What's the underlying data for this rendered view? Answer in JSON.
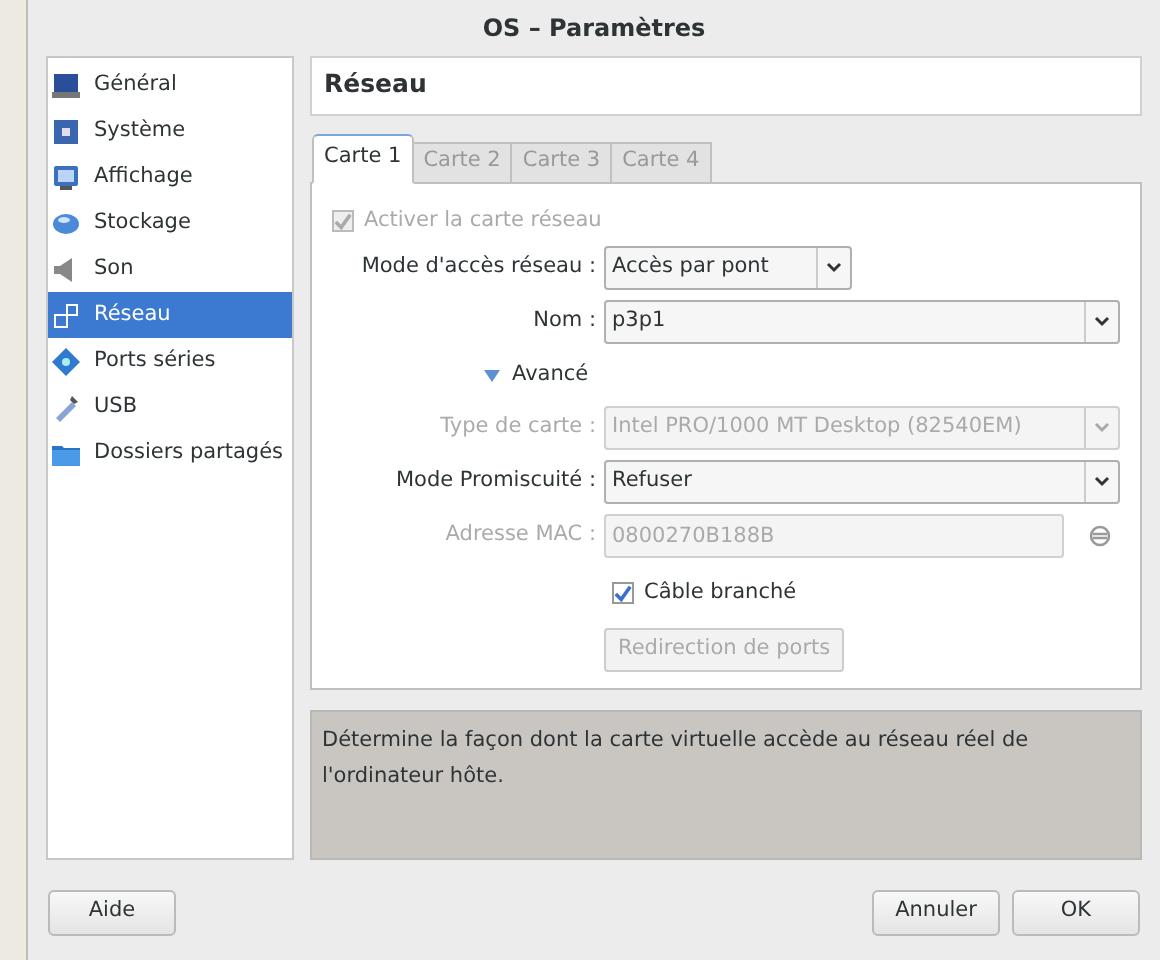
{
  "window": {
    "title": "OS – Paramètres"
  },
  "sidebar": {
    "items": [
      {
        "label": "Général",
        "selected": false
      },
      {
        "label": "Système",
        "selected": false
      },
      {
        "label": "Affichage",
        "selected": false
      },
      {
        "label": "Stockage",
        "selected": false
      },
      {
        "label": "Son",
        "selected": false
      },
      {
        "label": "Réseau",
        "selected": true
      },
      {
        "label": "Ports séries",
        "selected": false
      },
      {
        "label": "USB",
        "selected": false
      },
      {
        "label": "Dossiers partagés",
        "selected": false
      }
    ]
  },
  "page_title": "Réseau",
  "tabs": [
    {
      "label": "Carte 1",
      "selected": true
    },
    {
      "label": "Carte 2",
      "selected": false
    },
    {
      "label": "Carte 3",
      "selected": false
    },
    {
      "label": "Carte 4",
      "selected": false
    }
  ],
  "enable_checkbox": {
    "label": "Activer la carte réseau",
    "checked": true,
    "disabled": true
  },
  "form": [
    {
      "kind": "combo",
      "label": "Mode d'accès réseau :",
      "value": "Accès par pont",
      "disabled": false,
      "wide": false
    },
    {
      "kind": "combo",
      "label": "Nom :",
      "value": "p3p1",
      "disabled": false,
      "wide": true
    },
    {
      "kind": "expander",
      "label": "Avancé",
      "expanded": true
    },
    {
      "kind": "combo",
      "label": "Type de carte :",
      "value": "Intel PRO/1000 MT Desktop (82540EM)",
      "disabled": true,
      "wide": true
    },
    {
      "kind": "combo",
      "label": "Mode Promiscuité :",
      "value": "Refuser",
      "disabled": false,
      "wide": true
    },
    {
      "kind": "text",
      "label": "Adresse MAC :",
      "value": "0800270B188B",
      "disabled": true
    },
    {
      "kind": "checkbox",
      "label": "Câble branché",
      "checked": true,
      "disabled": false
    },
    {
      "kind": "button",
      "label": "Redirection de ports",
      "disabled": true
    }
  ],
  "description": "Détermine la façon dont la carte virtuelle accède au réseau réel de l'ordinateur hôte.",
  "buttons": {
    "help": "Aide",
    "cancel": "Annuler",
    "ok": "OK"
  }
}
